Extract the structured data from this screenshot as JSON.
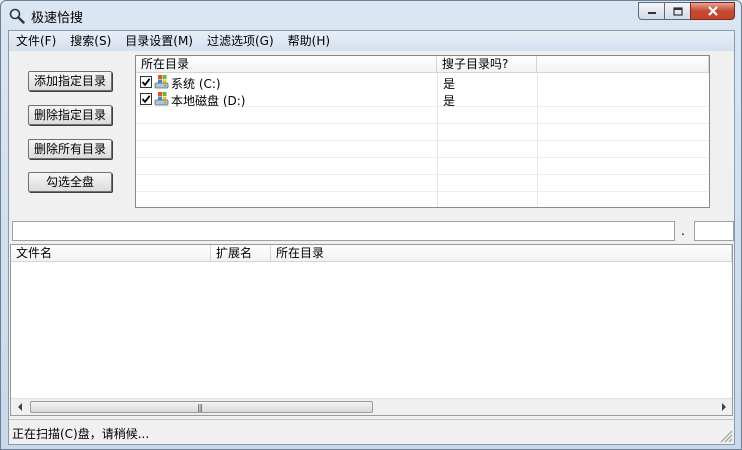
{
  "window": {
    "title": "极速恰搜"
  },
  "menu": {
    "items": [
      "文件(F)",
      "搜索(S)",
      "目录设置(M)",
      "过滤选项(G)",
      "帮助(H)"
    ]
  },
  "buttons": {
    "add_dir": "添加指定目录",
    "remove_dir": "删除指定目录",
    "remove_all": "删除所有目录",
    "check_all": "勾选全盘"
  },
  "dir_table": {
    "columns": [
      "所在目录",
      "搜子目录吗?"
    ],
    "rows": [
      {
        "label": "系统 (C:)",
        "checked": true,
        "search_sub": "是",
        "icon": "drive-icon"
      },
      {
        "label": "本地磁盘 (D:)",
        "checked": true,
        "search_sub": "是",
        "icon": "drive-icon"
      }
    ]
  },
  "search": {
    "name_value": "",
    "ext_value": "",
    "separator": "."
  },
  "results_table": {
    "columns": [
      "文件名",
      "扩展名",
      "所在目录"
    ],
    "rows": []
  },
  "status": {
    "text": "正在扫描(C)盘，请稍候..."
  },
  "colors": {
    "close_button": "#c7432b",
    "title_gradient": "#c9d8ea"
  }
}
